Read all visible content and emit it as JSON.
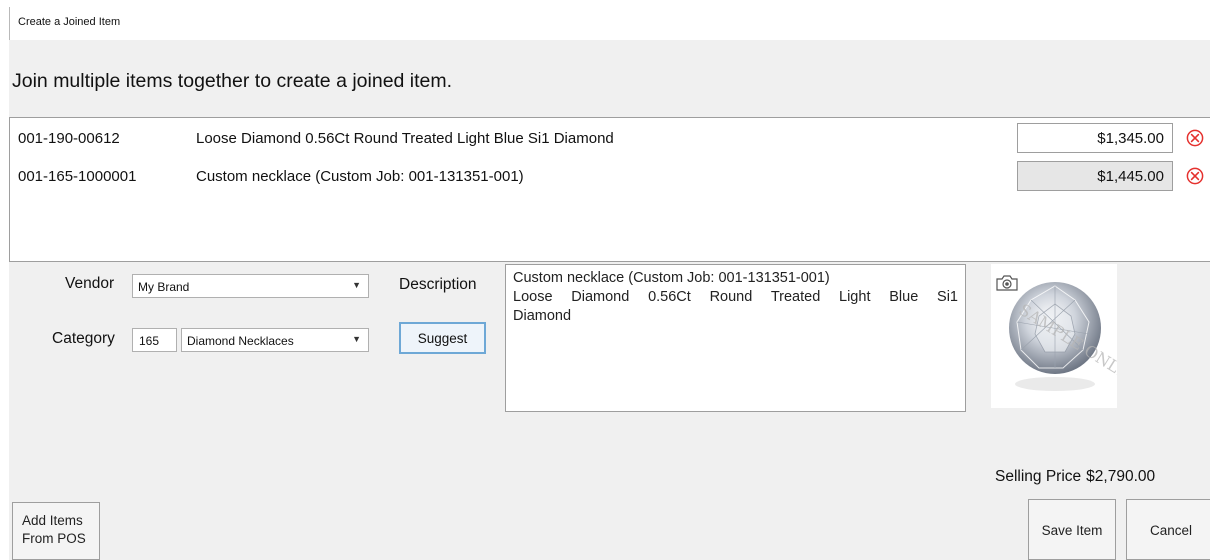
{
  "window": {
    "title": "Create a Joined Item"
  },
  "header": {
    "heading": "Join multiple items together to create a joined item."
  },
  "items": [
    {
      "sku": "001-190-00612",
      "description": "Loose Diamond 0.56Ct Round Treated Light Blue Si1 Diamond",
      "price": "$1,345.00",
      "price_editable": true
    },
    {
      "sku": "001-165-1000001",
      "description": "Custom necklace (Custom Job: 001-131351-001)",
      "price": "$1,445.00",
      "price_editable": false
    }
  ],
  "form": {
    "vendor_label": "Vendor",
    "vendor_value": "My Brand",
    "category_label": "Category",
    "category_code": "165",
    "category_value": "Diamond Necklaces",
    "description_label": "Description",
    "suggest_label": "Suggest",
    "description_lines": [
      "Custom necklace (Custom Job: 001-131351-001)",
      "Loose Diamond 0.56Ct Round Treated Light Blue Si1",
      "Diamond"
    ],
    "photo_icon": "camera-icon",
    "photo_watermark": "SAMPLE ONLY",
    "selling_price_label": "Selling Price",
    "selling_price_value": "$2,790.00"
  },
  "actions": {
    "add_items_line1": "Add Items",
    "add_items_line2": "From POS",
    "save_label": "Save Item",
    "cancel_label": "Cancel"
  },
  "colors": {
    "remove_red": "#e5312e",
    "focus_blue": "#6ea8d6",
    "panel_gray": "#f0f0f0"
  }
}
